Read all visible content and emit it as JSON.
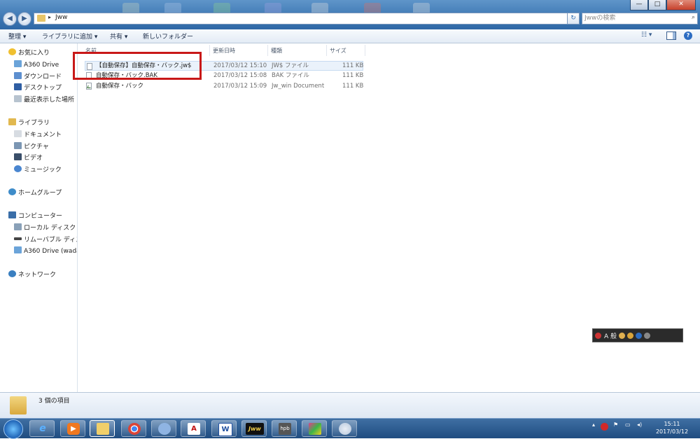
{
  "window": {
    "address_path": "Jww",
    "search_placeholder": "Jwwの検索",
    "controls": {
      "minimize": "—",
      "maximize": "□",
      "close": "✕"
    }
  },
  "toolbar": {
    "organize": "整理 ▾",
    "add_to_library": "ライブラリに追加 ▾",
    "share": "共有 ▾",
    "new_folder": "新しいフォルダー"
  },
  "sidebar": {
    "favorites_header": "お気に入り",
    "favorites": [
      "A360 Drive",
      "ダウンロード",
      "デスクトップ",
      "最近表示した場所"
    ],
    "libraries_header": "ライブラリ",
    "libraries": [
      "ドキュメント",
      "ピクチャ",
      "ビデオ",
      "ミュージック"
    ],
    "homegroup": "ホームグループ",
    "computer_header": "コンピューター",
    "computer": [
      "ローカル ディスク (",
      "リムーバブル ディス",
      "A360 Drive (wada"
    ],
    "network": "ネットワーク"
  },
  "columns": {
    "name": "名前",
    "date": "更新日時",
    "type": "種類",
    "size": "サイズ"
  },
  "files": [
    {
      "name": "【自動保存】自動保存・バック.jw$",
      "date": "2017/03/12 15:10",
      "type": "JW$ ファイル",
      "size": "111 KB"
    },
    {
      "name": "自動保存・バック.BAK",
      "date": "2017/03/12 15:08",
      "type": "BAK ファイル",
      "size": "111 KB"
    },
    {
      "name": "自動保存・バック",
      "date": "2017/03/12 15:09",
      "type": "Jw_win Document",
      "size": "111 KB"
    }
  ],
  "status": {
    "item_count": "3 個の項目"
  },
  "language_bar": {
    "mode": "A 般"
  },
  "taskbar": {
    "apps": [
      "internet-explorer",
      "media-player",
      "file-explorer",
      "chrome",
      "thunderbird",
      "acrobat",
      "word",
      "jww",
      "hpb",
      "paint-app",
      "paint"
    ],
    "app_labels": {
      "acrobat": "A",
      "word": "W",
      "jww": "Jww",
      "hpb": "hpb"
    },
    "time": "15:11",
    "date": "2017/03/12"
  },
  "colors": {
    "titlebar": "#3d77b3",
    "selection": "#eaf2fb",
    "highlight_box": "#c81818",
    "taskbar": "#1f4c80"
  }
}
